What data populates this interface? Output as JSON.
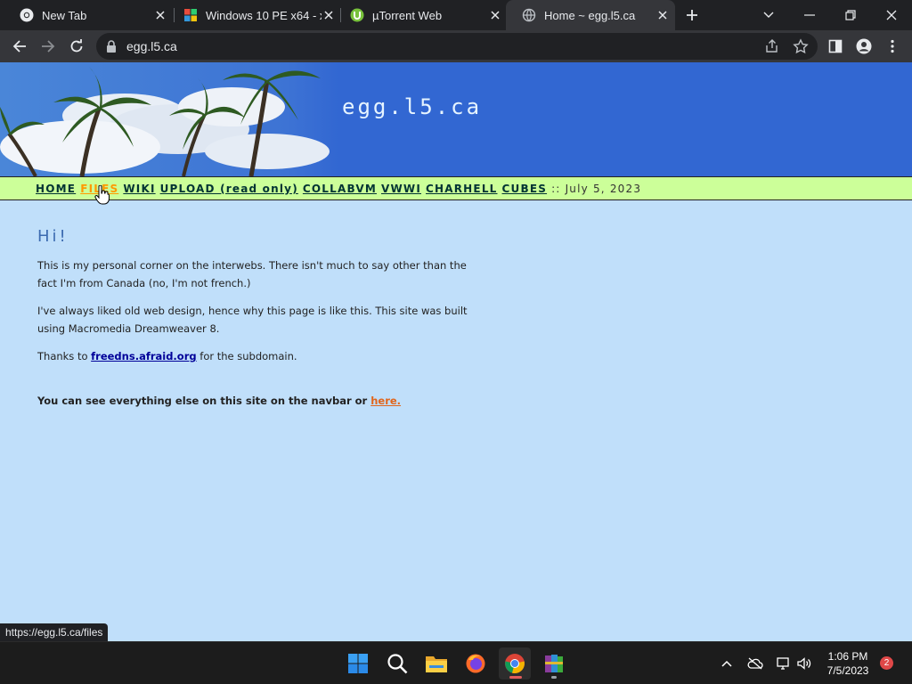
{
  "browser": {
    "tabs": [
      {
        "title": "New Tab",
        "favicon": "chrome-icon"
      },
      {
        "title": "Windows 10 PE x64 - x",
        "favicon": "windows-color-icon"
      },
      {
        "title": "µTorrent Web",
        "favicon": "utorrent-icon"
      },
      {
        "title": "Home ~ egg.l5.ca",
        "favicon": "globe-icon",
        "active": true
      }
    ],
    "address": "egg.l5.ca",
    "status_url": "https://egg.l5.ca/files"
  },
  "site": {
    "title": "egg.l5.ca",
    "nav": [
      {
        "label": "HOME"
      },
      {
        "label": "FILES",
        "hover": true
      },
      {
        "label": "WIKI"
      },
      {
        "label": "UPLOAD (read only)"
      },
      {
        "label": "COLLABVM"
      },
      {
        "label": "VWWI"
      },
      {
        "label": "CHARHELL"
      },
      {
        "label": "CUBES"
      }
    ],
    "date": ":: July 5, 2023"
  },
  "content": {
    "heading": "Hi!",
    "p1": "This is my personal corner on the interwebs. There isn't much to say other than the fact I'm from Canada (no, I'm not french.)",
    "p2": "I've always liked old web design, hence why this page is like this. This site was built using Macromedia Dreamweaver 8.",
    "p3_before": "Thanks to ",
    "p3_link": "freedns.afraid.org",
    "p3_after": " for the subdomain.",
    "p4_text": "You can see everything else on this site on the navbar or ",
    "p4_link": "here."
  },
  "taskbar": {
    "time": "1:06 PM",
    "date": "7/5/2023",
    "notifications": "2",
    "apps": [
      "start-icon",
      "search-icon",
      "file-explorer-icon",
      "firefox-icon",
      "chrome-icon",
      "winrar-icon"
    ]
  },
  "colors": {
    "page_bg": "#c0dffa",
    "banner_bg": "#3267d2",
    "navbar_bg": "#ccff99",
    "link_hover": "#ff9900",
    "heading": "#3c6bb0"
  }
}
